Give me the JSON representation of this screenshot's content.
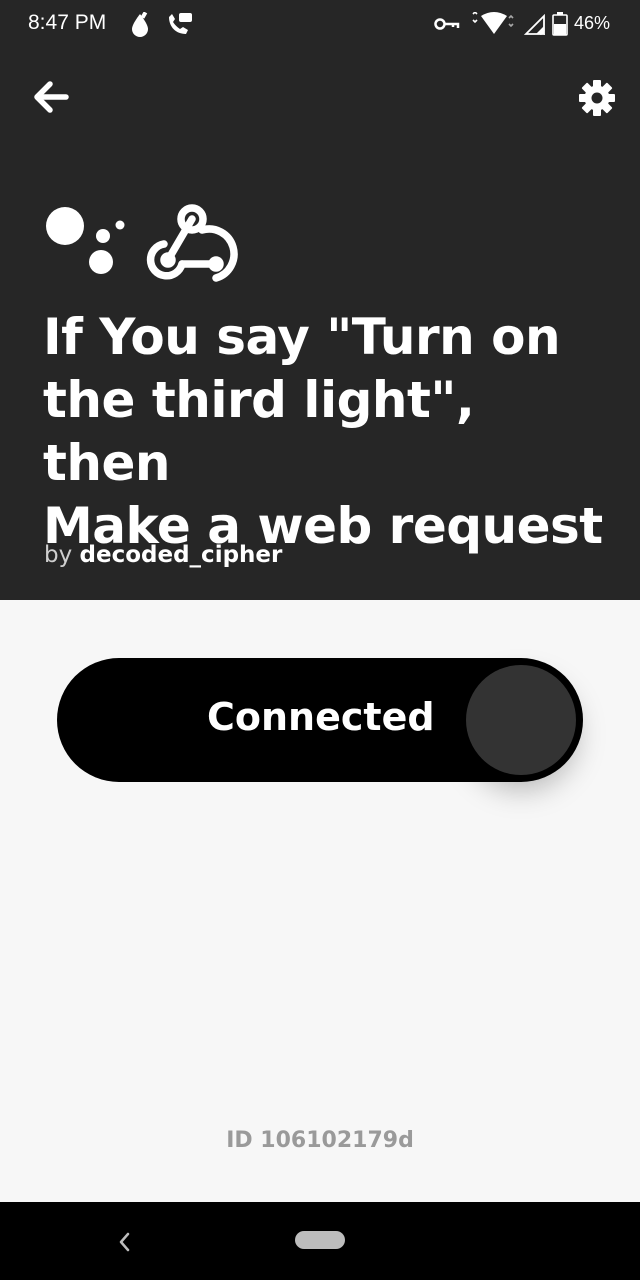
{
  "status_bar": {
    "time": "8:47 PM",
    "battery_percent": "46%",
    "icons": [
      "drop-icon",
      "call-icon",
      "vpn-key-icon",
      "wifi-icon",
      "signal-icon",
      "battery-icon"
    ]
  },
  "header": {
    "back_icon": "arrow-left-icon",
    "settings_icon": "gear-icon",
    "service_icons": [
      "google-assistant-icon",
      "webhooks-icon"
    ],
    "title_lines": [
      "If You say \"Turn on",
      "the third light\", then",
      "Make a web request"
    ],
    "by_prefix": "by",
    "author": "decoded_cipher",
    "background_color": "#262626"
  },
  "toggle": {
    "label": "Connected",
    "connected": true,
    "background_color": "#000000"
  },
  "footer": {
    "applet_id": "ID 106102179d"
  },
  "system_nav": {
    "back_icon": "chevron-left-icon",
    "home_icon": "home-pill-icon"
  }
}
